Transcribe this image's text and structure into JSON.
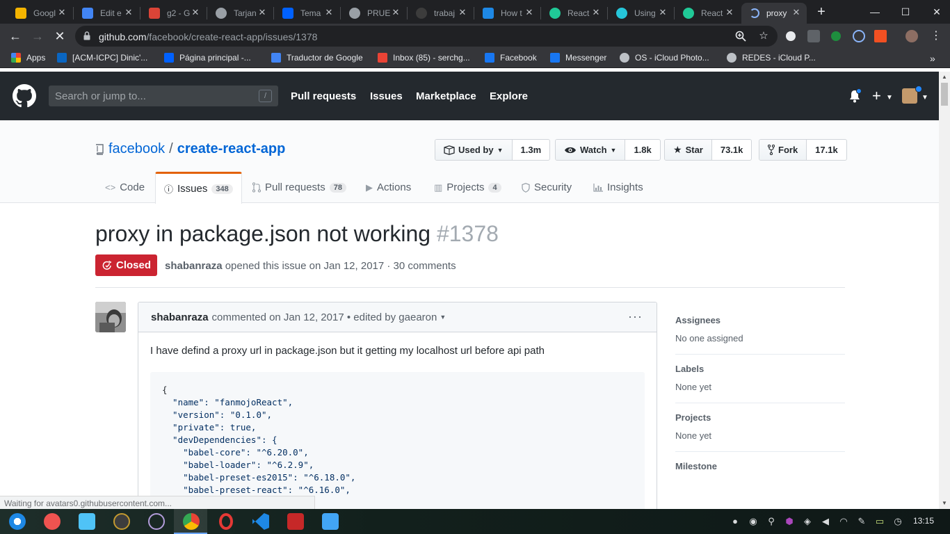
{
  "browser": {
    "tabs": [
      {
        "title": "Googl",
        "color": "#f4b400"
      },
      {
        "title": "Edit e",
        "color": "#4285f4"
      },
      {
        "title": "g2 - G",
        "color": "#db4437"
      },
      {
        "title": "Tarjan",
        "color": "#9aa0a6"
      },
      {
        "title": "Tema",
        "color": "#0061ff"
      },
      {
        "title": "PRUE",
        "color": "#9aa0a6"
      },
      {
        "title": "trabaj",
        "color": "#3c3c3c"
      },
      {
        "title": "How t",
        "color": "#1e88e5"
      },
      {
        "title": "React",
        "color": "#20c997"
      },
      {
        "title": "Using",
        "color": "#26c6da"
      },
      {
        "title": "React",
        "color": "#20c997"
      },
      {
        "title": "proxy",
        "color": "#35363a"
      }
    ],
    "url_host": "github.com",
    "url_path": "/facebook/create-react-app/issues/1378",
    "bookmarks": [
      "Apps",
      "[ACM-ICPC] Dinic'...",
      "Página principal -...",
      "Traductor de Google",
      "Inbox (85) - serchg...",
      "Facebook",
      "Messenger",
      "OS - iCloud Photo...",
      "REDES - iCloud P..."
    ],
    "status_text": "Waiting for avatars0.githubusercontent.com..."
  },
  "github": {
    "search_placeholder": "Search or jump to...",
    "search_shortcut": "/",
    "nav": [
      "Pull requests",
      "Issues",
      "Marketplace",
      "Explore"
    ],
    "repo": {
      "owner": "facebook",
      "name": "create-react-app",
      "used_by_label": "Used by",
      "used_by_count": "1.3m",
      "watch_label": "Watch",
      "watch_count": "1.8k",
      "star_label": "Star",
      "star_count": "73.1k",
      "fork_label": "Fork",
      "fork_count": "17.1k"
    },
    "repo_tabs": {
      "code": "Code",
      "issues": "Issues",
      "issues_count": "348",
      "pulls": "Pull requests",
      "pulls_count": "78",
      "actions": "Actions",
      "projects": "Projects",
      "projects_count": "4",
      "security": "Security",
      "insights": "Insights"
    },
    "issue": {
      "title": "proxy in package.json not working",
      "number": "#1378",
      "state": "Closed",
      "author": "shabanraza",
      "opened_text": "opened this issue on Jan 12, 2017 · 30 comments"
    },
    "comment": {
      "author": "shabanraza",
      "meta": "commented on Jan 12, 2017 • edited by gaearon",
      "body": "I have defind a proxy url in package.json but it getting my localhost url before api path",
      "code_lines": [
        "{",
        "  \"name\": \"fanmojoReact\",",
        "  \"version\": \"0.1.0\",",
        "  \"private\": true,",
        "  \"devDependencies\": {",
        "    \"babel-core\": \"^6.20.0\",",
        "    \"babel-loader\": \"^6.2.9\",",
        "    \"babel-preset-es2015\": \"^6.18.0\",",
        "    \"babel-preset-react\": \"^6.16.0\","
      ]
    },
    "sidebar": [
      {
        "heading": "Assignees",
        "value": "No one assigned"
      },
      {
        "heading": "Labels",
        "value": "None yet"
      },
      {
        "heading": "Projects",
        "value": "None yet"
      },
      {
        "heading": "Milestone",
        "value": ""
      }
    ]
  },
  "system": {
    "clock": "13:15"
  }
}
